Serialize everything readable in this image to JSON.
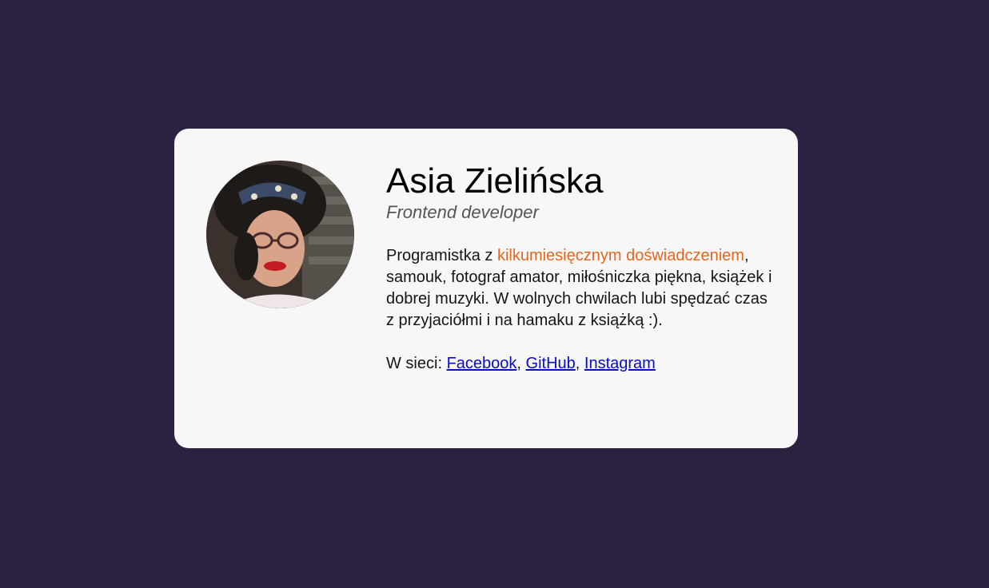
{
  "profile": {
    "name": "Asia Zielińska",
    "role": "Frontend developer",
    "avatar_alt": "profile-photo"
  },
  "bio": {
    "prefix": "Programistka z ",
    "highlight": "kilkumiesięcznym doświadczeniem",
    "suffix": ", samouk, fotograf amator, miłośniczka piękna, książek i dobrej muzyki. W wolnych chwilach lubi spędzać czas z przyjaciółmi i na hamaku z książką :)."
  },
  "social": {
    "label": "W sieci: ",
    "sep": ", ",
    "links": [
      "Facebook",
      "GitHub",
      "Instagram"
    ]
  },
  "colors": {
    "background": "#2d2142",
    "card": "#f7f7f7",
    "accent": "#e5661f",
    "link": "#0b0bd0"
  }
}
